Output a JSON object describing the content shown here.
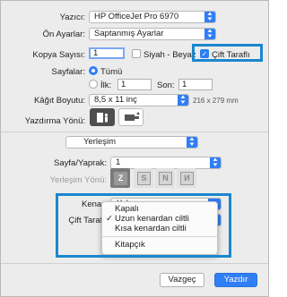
{
  "printer": {
    "label": "Yazıcı:",
    "value": "HP OfficeJet Pro 6970"
  },
  "presets": {
    "label": "Ön Ayarlar:",
    "value": "Saptanmış Ayarlar"
  },
  "copies": {
    "label": "Kopya Sayısı:",
    "value": "1",
    "bw_label": "Siyah - Beyaz",
    "duplex_label": "Çift Taraflı",
    "duplex_checkmark": "✓"
  },
  "pages": {
    "label": "Sayfalar:",
    "all_label": "Tümü",
    "from_label": "İlk:",
    "from_value": "1",
    "to_label": "Son:",
    "to_value": "1"
  },
  "paper": {
    "label": "Kâğıt Boyutu:",
    "value": "8,5 x 11 inç",
    "dims": "216 x 279 mm"
  },
  "orientation": {
    "label": "Yazdırma Yönü:"
  },
  "panel": {
    "value": "Yerleşim"
  },
  "layout": {
    "pages_per_sheet_label": "Sayfa/Yaprak:",
    "pages_per_sheet_value": "1",
    "direction_label": "Yerleşim Yönü:",
    "border_label": "Kenar:",
    "border_value": "Yok",
    "two_sided_label": "Çift Taraflı"
  },
  "duplex_menu": {
    "items": [
      "Kapalı",
      "Uzun kenardan ciltli",
      "Kısa kenardan ciltli",
      "Kitapçık"
    ],
    "selected_mark": "✓"
  },
  "buttons": {
    "cancel": "Vazgeç",
    "print": "Yazdır"
  },
  "colors": {
    "accent": "#2f7ef6",
    "highlight": "#1a87cf"
  }
}
